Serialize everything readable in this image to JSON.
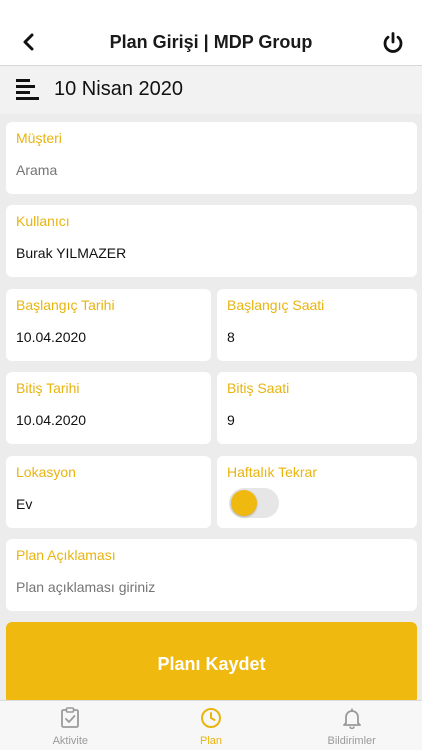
{
  "header": {
    "title": "Plan Girişi | MDP Group"
  },
  "datebar": {
    "date": "10 Nisan 2020"
  },
  "form": {
    "customer": {
      "label": "Müşteri",
      "placeholder": "Arama"
    },
    "user": {
      "label": "Kullanıcı",
      "value": "Burak YILMAZER"
    },
    "start_date": {
      "label": "Başlangıç Tarihi",
      "value": "10.04.2020"
    },
    "start_time": {
      "label": "Başlangıç Saati",
      "value": "8"
    },
    "end_date": {
      "label": "Bitiş Tarihi",
      "value": "10.04.2020"
    },
    "end_time": {
      "label": "Bitiş Saati",
      "value": "9"
    },
    "location": {
      "label": "Lokasyon",
      "value": "Ev"
    },
    "weekly_repeat": {
      "label": "Haftalık Tekrar",
      "on": false
    },
    "description": {
      "label": "Plan Açıklaması",
      "placeholder": "Plan açıklaması giriniz"
    }
  },
  "save_button": {
    "label": "Planı Kaydet"
  },
  "tabs": [
    {
      "label": "Aktivite",
      "icon": "clipboard-check-icon",
      "active": false
    },
    {
      "label": "Plan",
      "icon": "clock-icon",
      "active": true
    },
    {
      "label": "Bildirimler",
      "icon": "bell-icon",
      "active": false
    }
  ],
  "colors": {
    "accent": "#f0b90f",
    "label": "#e8b40e",
    "inactive_tab": "#9a9a9a"
  }
}
